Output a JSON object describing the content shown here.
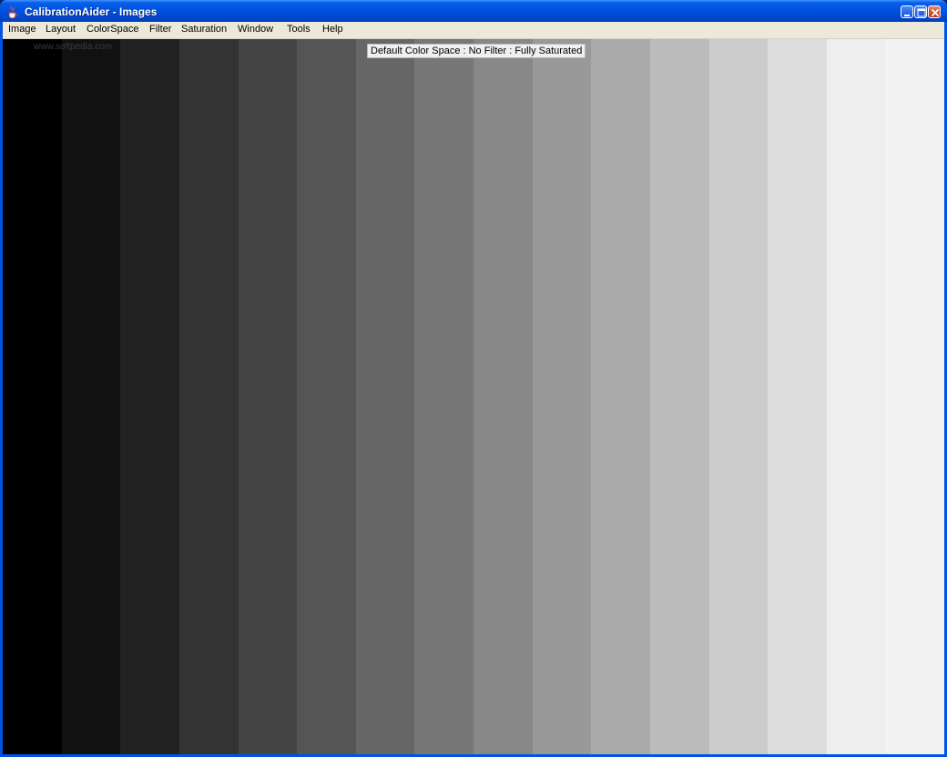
{
  "window": {
    "title": "CalibrationAider - Images",
    "icon": "java-cup-icon"
  },
  "menu": {
    "items": [
      "Image",
      "Layout",
      "ColorSpace",
      "Filter",
      "Saturation",
      "Window",
      "Tools",
      "Help"
    ]
  },
  "content": {
    "watermark": "www.softpedia.com",
    "status_label": "Default Color Space : No Filter : Fully Saturated",
    "gray_steps": [
      "#000000",
      "#111111",
      "#222222",
      "#333333",
      "#444444",
      "#555555",
      "#666666",
      "#777777",
      "#888888",
      "#999999",
      "#aaaaaa",
      "#bbbbbb",
      "#cccccc",
      "#dddddd",
      "#eeeeee",
      "#f2f2f2"
    ]
  }
}
